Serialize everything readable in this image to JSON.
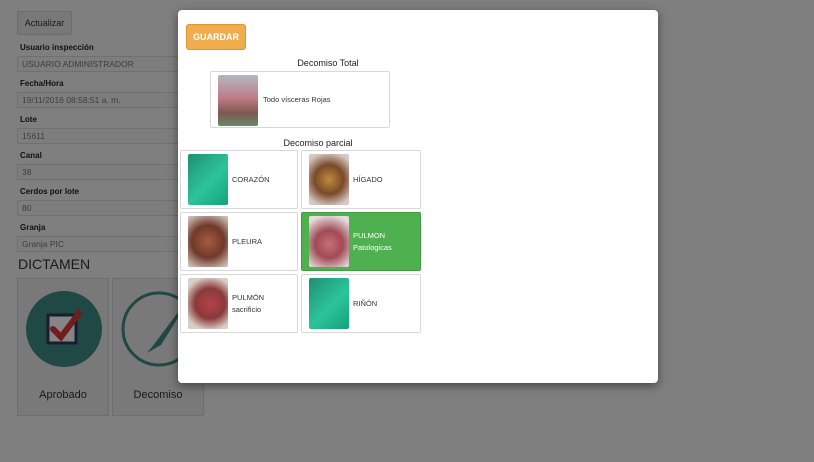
{
  "form": {
    "refresh_label": "Actualizar",
    "fields": [
      {
        "label": "Usuario inspección",
        "value": "USUARIO ADMINISTRADOR"
      },
      {
        "label": "Fecha/Hora",
        "value": "19/11/2016 08:58:51 a. m."
      },
      {
        "label": "Lote",
        "value": "15611"
      },
      {
        "label": "Canal",
        "value": "38"
      },
      {
        "label": "Cerdos por lote",
        "value": "80"
      },
      {
        "label": "Granja",
        "value": "Granja PIC"
      }
    ],
    "dictamen_title": "DICTAMEN",
    "tiles": [
      {
        "label": "Aprobado",
        "icon": "checkbox-check-icon"
      },
      {
        "label": "Decomiso",
        "icon": "knife-icon"
      }
    ]
  },
  "modal": {
    "save_label": "GUARDAR",
    "total_title": "Decomiso Total",
    "total_item": {
      "label": "Todo vísceras Rojas",
      "icon": "carcass-photo"
    },
    "partial_title": "Decomiso parcial",
    "partial_items": [
      {
        "label": "CORAZÓN",
        "selected": false,
        "icon": "green-placeholder-photo"
      },
      {
        "label": "HÍGADO",
        "selected": false,
        "icon": "liver-photo"
      },
      {
        "label": "PLEURA",
        "selected": false,
        "icon": "pleura-photo"
      },
      {
        "label": "PULMON\nPatologicas",
        "selected": true,
        "icon": "lungs-photo"
      },
      {
        "label": "PULMÓN\nsacrificio",
        "selected": false,
        "icon": "lungs-sacrifice-photo"
      },
      {
        "label": "RIÑÓN",
        "selected": false,
        "icon": "green-placeholder-photo"
      }
    ],
    "selected_color": "#4fb04f",
    "save_color": "#f0ad4e"
  }
}
